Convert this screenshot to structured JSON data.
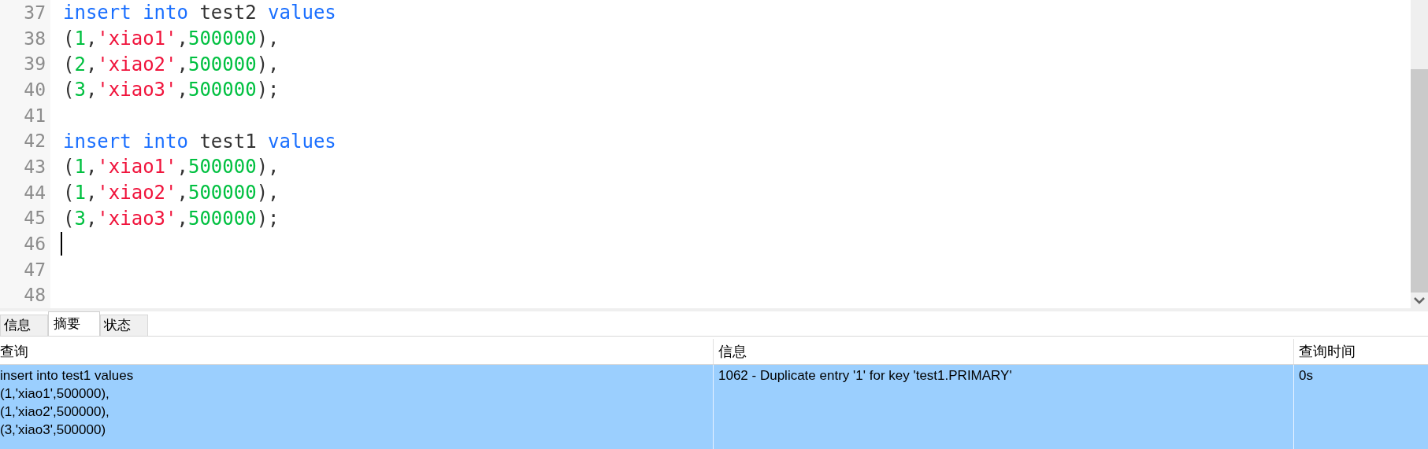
{
  "editor": {
    "lines": [
      {
        "number": "37",
        "cursor": false,
        "tokens": [
          {
            "kind": "keyword",
            "text": "insert"
          },
          {
            "kind": "keyword",
            "text": " into"
          },
          {
            "kind": "plain",
            "text": " test2"
          },
          {
            "kind": "keyword",
            "text": " values"
          }
        ]
      },
      {
        "number": "38",
        "cursor": false,
        "tokens": [
          {
            "kind": "plain",
            "text": "("
          },
          {
            "kind": "number",
            "text": "1"
          },
          {
            "kind": "plain",
            "text": ","
          },
          {
            "kind": "string",
            "text": "'xiao1'"
          },
          {
            "kind": "plain",
            "text": ","
          },
          {
            "kind": "number",
            "text": "500000"
          },
          {
            "kind": "plain",
            "text": "),"
          }
        ]
      },
      {
        "number": "39",
        "cursor": false,
        "tokens": [
          {
            "kind": "plain",
            "text": "("
          },
          {
            "kind": "number",
            "text": "2"
          },
          {
            "kind": "plain",
            "text": ","
          },
          {
            "kind": "string",
            "text": "'xiao2'"
          },
          {
            "kind": "plain",
            "text": ","
          },
          {
            "kind": "number",
            "text": "500000"
          },
          {
            "kind": "plain",
            "text": "),"
          }
        ]
      },
      {
        "number": "40",
        "cursor": false,
        "tokens": [
          {
            "kind": "plain",
            "text": "("
          },
          {
            "kind": "number",
            "text": "3"
          },
          {
            "kind": "plain",
            "text": ","
          },
          {
            "kind": "string",
            "text": "'xiao3'"
          },
          {
            "kind": "plain",
            "text": ","
          },
          {
            "kind": "number",
            "text": "500000"
          },
          {
            "kind": "plain",
            "text": ");"
          }
        ]
      },
      {
        "number": "41",
        "cursor": false
      },
      {
        "number": "42",
        "cursor": false,
        "tokens": [
          {
            "kind": "keyword",
            "text": "insert"
          },
          {
            "kind": "keyword",
            "text": " into"
          },
          {
            "kind": "plain",
            "text": " test1"
          },
          {
            "kind": "keyword",
            "text": " values"
          }
        ]
      },
      {
        "number": "43",
        "cursor": false,
        "tokens": [
          {
            "kind": "plain",
            "text": "("
          },
          {
            "kind": "number",
            "text": "1"
          },
          {
            "kind": "plain",
            "text": ","
          },
          {
            "kind": "string",
            "text": "'xiao1'"
          },
          {
            "kind": "plain",
            "text": ","
          },
          {
            "kind": "number",
            "text": "500000"
          },
          {
            "kind": "plain",
            "text": "),"
          }
        ]
      },
      {
        "number": "44",
        "cursor": false,
        "tokens": [
          {
            "kind": "plain",
            "text": "("
          },
          {
            "kind": "number",
            "text": "1"
          },
          {
            "kind": "plain",
            "text": ","
          },
          {
            "kind": "string",
            "text": "'xiao2'"
          },
          {
            "kind": "plain",
            "text": ","
          },
          {
            "kind": "number",
            "text": "500000"
          },
          {
            "kind": "plain",
            "text": "),"
          }
        ]
      },
      {
        "number": "45",
        "cursor": false,
        "tokens": [
          {
            "kind": "plain",
            "text": "("
          },
          {
            "kind": "number",
            "text": "3"
          },
          {
            "kind": "plain",
            "text": ","
          },
          {
            "kind": "string",
            "text": "'xiao3'"
          },
          {
            "kind": "plain",
            "text": ","
          },
          {
            "kind": "number",
            "text": "500000"
          },
          {
            "kind": "plain",
            "text": ");"
          }
        ]
      },
      {
        "number": "46",
        "cursor": true
      },
      {
        "number": "47",
        "cursor": false
      },
      {
        "number": "48",
        "cursor": false
      }
    ]
  },
  "tabs": [
    {
      "label": "信息",
      "selected": false
    },
    {
      "label": "摘要",
      "selected": true
    },
    {
      "label": "状态",
      "selected": false
    }
  ],
  "table": {
    "columns": [
      "查询",
      "信息",
      "查询时间"
    ],
    "rows": [
      {
        "selected": true,
        "cells": [
          [
            "insert into test1 values",
            "(1,'xiao1',500000),",
            "(1,'xiao2',500000),",
            "(3,'xiao3',500000)"
          ],
          [
            "1062 - Duplicate entry '1' for key 'test1.PRIMARY'"
          ],
          [
            "0s"
          ]
        ]
      }
    ]
  }
}
